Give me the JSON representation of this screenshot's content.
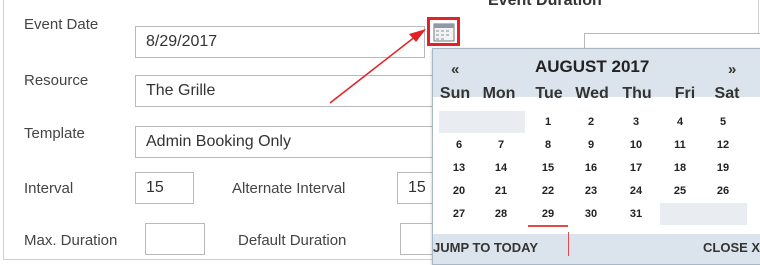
{
  "form": {
    "event_date_label": "Event Date",
    "event_date_value": "8/29/2017",
    "resource_label": "Resource",
    "resource_value": "The Grille",
    "template_label": "Template",
    "template_value": "Admin Booking Only",
    "interval_label": "Interval",
    "interval_value": "15",
    "alt_interval_label": "Alternate Interval",
    "alt_interval_value": "15",
    "max_duration_label": "Max. Duration",
    "max_duration_value": "",
    "default_duration_label": "Default Duration",
    "default_duration_value": ""
  },
  "right_panel": {
    "title": "Event Duration"
  },
  "datepicker": {
    "prev": "«",
    "next": "»",
    "month_label": "AUGUST 2017",
    "weekdays": [
      "Sun",
      "Mon",
      "Tue",
      "Wed",
      "Thu",
      "Fri",
      "Sat"
    ],
    "weeks": [
      [
        "",
        "",
        "1",
        "2",
        "3",
        "4",
        "5"
      ],
      [
        "6",
        "7",
        "8",
        "9",
        "10",
        "11",
        "12"
      ],
      [
        "13",
        "14",
        "15",
        "16",
        "17",
        "18",
        "19"
      ],
      [
        "20",
        "21",
        "22",
        "23",
        "24",
        "25",
        "26"
      ],
      [
        "27",
        "28",
        "29",
        "30",
        "31",
        "",
        ""
      ]
    ],
    "selected_day": "29",
    "jump_label": "JUMP TO TODAY",
    "close_label": "CLOSE X"
  },
  "icons": {
    "calendar": "calendar-icon"
  },
  "colors": {
    "highlight_red": "#e32227",
    "picker_bg": "#dbe4ed"
  }
}
